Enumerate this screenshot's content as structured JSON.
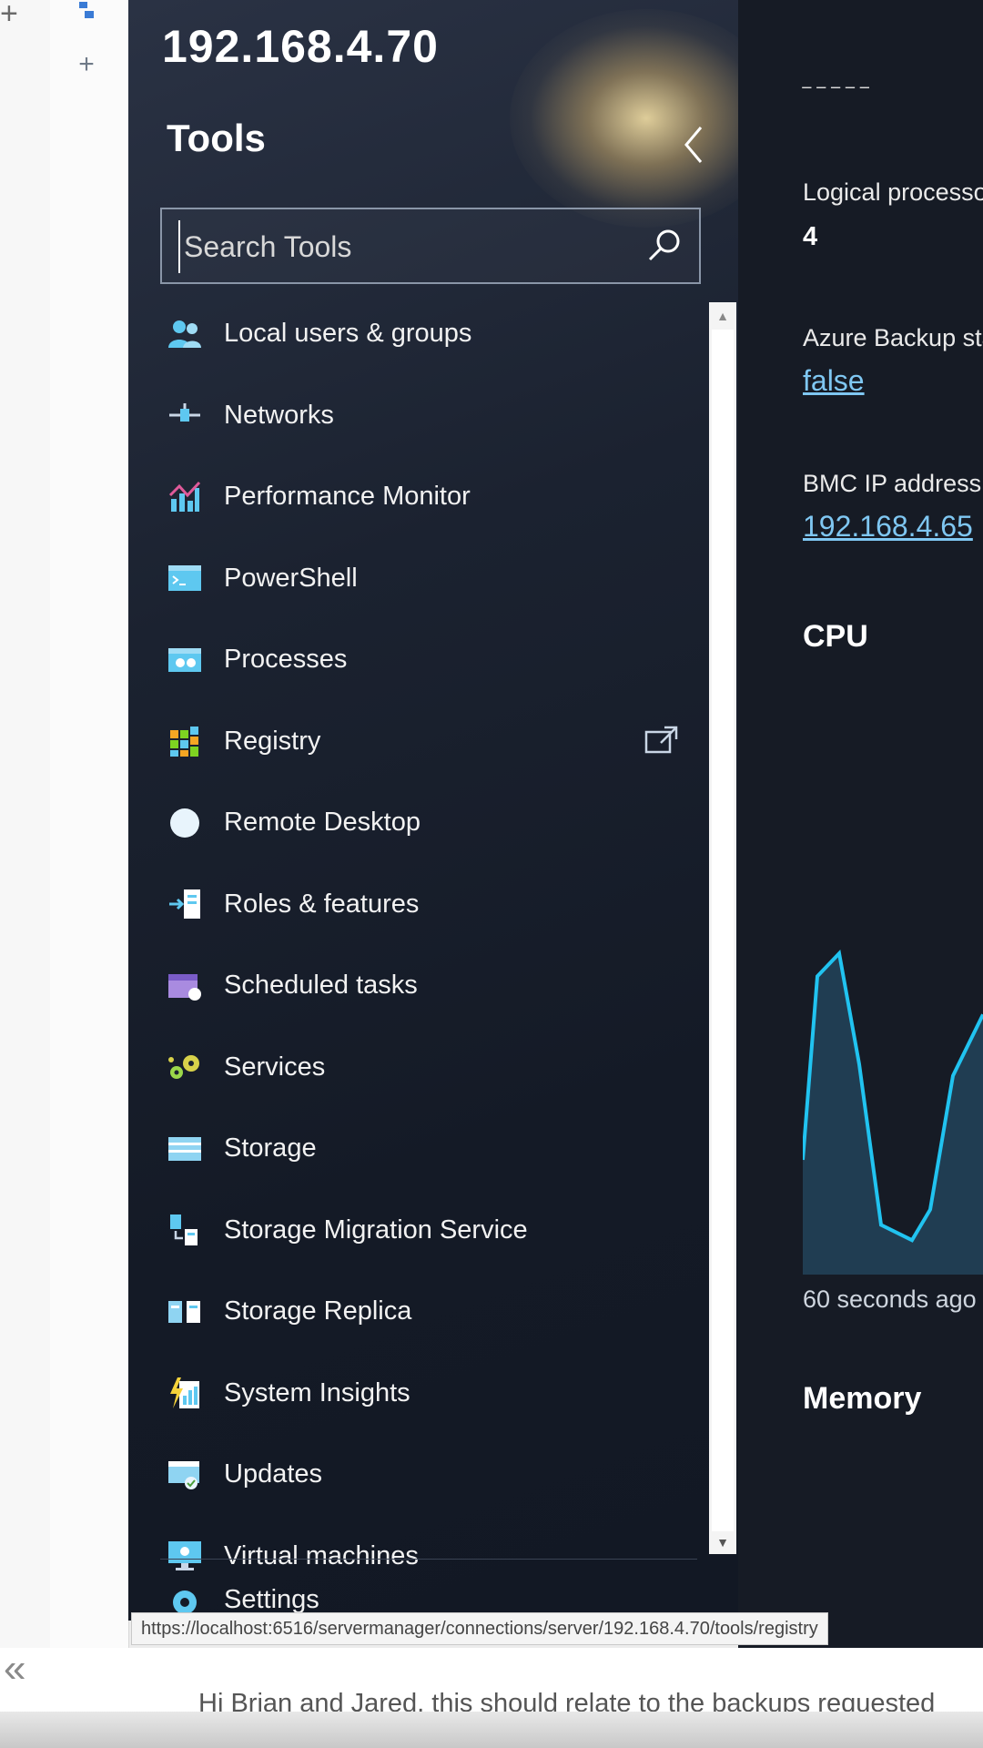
{
  "window": {
    "server_name": "192.168.4.70",
    "status_url": "https://localhost:6516/servermanager/connections/server/192.168.4.70/tools/registry"
  },
  "tools_panel": {
    "title": "Tools",
    "search": {
      "placeholder": "Search Tools",
      "value": ""
    },
    "items": [
      {
        "label": "Local users & groups",
        "icon": "users-icon"
      },
      {
        "label": "Networks",
        "icon": "network-icon"
      },
      {
        "label": "Performance Monitor",
        "icon": "performance-icon"
      },
      {
        "label": "PowerShell",
        "icon": "powershell-icon"
      },
      {
        "label": "Processes",
        "icon": "processes-icon"
      },
      {
        "label": "Registry",
        "icon": "registry-icon",
        "external": true
      },
      {
        "label": "Remote Desktop",
        "icon": "remote-desktop-icon"
      },
      {
        "label": "Roles & features",
        "icon": "roles-icon"
      },
      {
        "label": "Scheduled tasks",
        "icon": "calendar-icon"
      },
      {
        "label": "Services",
        "icon": "gears-icon"
      },
      {
        "label": "Storage",
        "icon": "storage-icon"
      },
      {
        "label": "Storage Migration Service",
        "icon": "migration-icon"
      },
      {
        "label": "Storage Replica",
        "icon": "replica-icon"
      },
      {
        "label": "System Insights",
        "icon": "insights-icon"
      },
      {
        "label": "Updates",
        "icon": "updates-icon"
      },
      {
        "label": "Virtual machines",
        "icon": "vm-icon"
      }
    ],
    "settings_label": "Settings"
  },
  "details": {
    "logical_processors_label": "Logical processor",
    "logical_processors_value": "4",
    "azure_backup_label": "Azure Backup sta",
    "azure_backup_value": "false",
    "bmc_ip_label": "BMC IP address",
    "bmc_ip_value": "192.168.4.65",
    "cpu_heading": "CPU",
    "cpu_time_label": "60 seconds ago",
    "memory_heading": "Memory",
    "cpu_chart": {
      "type": "area",
      "values": [
        0.3,
        0.78,
        0.84,
        0.55,
        0.13,
        0.09,
        0.17,
        0.52,
        0.68
      ],
      "ylim": [
        0,
        1
      ],
      "line_color": "#21c3f0"
    }
  },
  "email_preview": "Hi Brian and Jared, this should relate to the backups requested"
}
